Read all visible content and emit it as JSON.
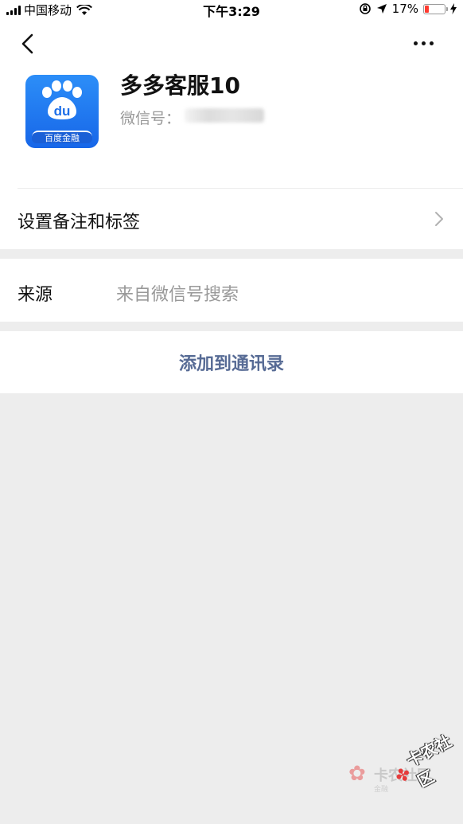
{
  "status_bar": {
    "carrier": "中国移动",
    "time": "下午3:29",
    "battery_percent": "17%"
  },
  "header": {
    "back_icon": "chevron-left-icon",
    "more_icon": "more-dots-icon"
  },
  "profile": {
    "avatar_icon": "baidu-paw-icon",
    "avatar_caption": "百度金融",
    "name": "多多客服10",
    "wechat_id_label": "微信号："
  },
  "rows": {
    "remark_label": "设置备注和标签",
    "source_label": "来源",
    "source_value": "来自微信号搜索"
  },
  "actions": {
    "add_contact_label": "添加到通讯录"
  },
  "watermark": {
    "text_a": "卡农社区",
    "sub_a": "金融",
    "text_b": "卡农社区"
  },
  "colors": {
    "link": "#576b95",
    "background": "#ededed",
    "battery_low": "#ff3b30",
    "avatar_blue": "#1766e8"
  }
}
